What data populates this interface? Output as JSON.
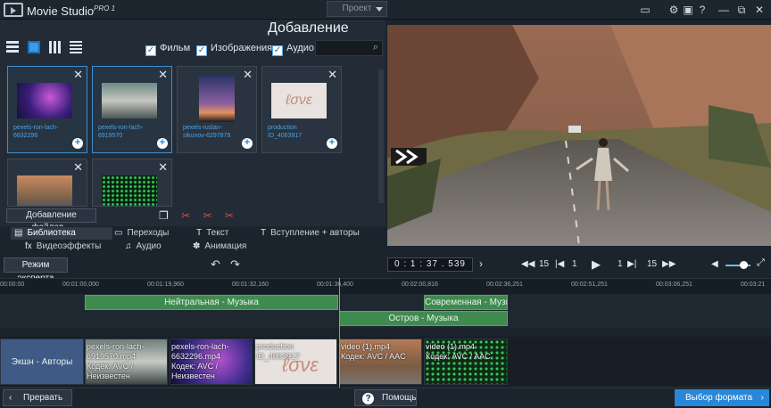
{
  "app": {
    "name": "Movie Studio",
    "edition": "PRO",
    "edition_sup": "1"
  },
  "header": {
    "project_button": "Проект"
  },
  "media": {
    "title": "Добавление",
    "filters": [
      {
        "label": "Фильм",
        "checked": true
      },
      {
        "label": "Изображения",
        "checked": true
      },
      {
        "label": "Аудио",
        "checked": true
      }
    ],
    "tiles": [
      {
        "name": "pexels-ron-lach-6632296",
        "selected": true
      },
      {
        "name": "pexels-ron-lach-6919570",
        "selected": true
      },
      {
        "name": "pexels-ruslan-sikunov-6297879",
        "selected": false
      },
      {
        "name": "production ID_4063917",
        "selected": false
      },
      {
        "name": "",
        "selected": false
      },
      {
        "name": "",
        "selected": false
      }
    ],
    "add_files_button": "Добавление файлов..."
  },
  "tabs": {
    "row1": [
      {
        "label": "Библиотека",
        "icon": "library-icon",
        "active": true
      },
      {
        "label": "Переходы",
        "icon": "transitions-icon",
        "active": false
      },
      {
        "label": "Текст",
        "icon": "text-icon",
        "active": false
      },
      {
        "label": "Вступление + авторы",
        "icon": "credits-icon",
        "active": false
      }
    ],
    "row2": [
      {
        "label": "Видеоэффекты",
        "icon": "fx-icon",
        "active": false
      },
      {
        "label": "Аудио",
        "icon": "music-note-icon",
        "active": false
      },
      {
        "label": "Анимация",
        "icon": "animation-icon",
        "active": false
      }
    ]
  },
  "controls": {
    "expert_mode": "Режим эксперта",
    "timecode": "0 : 1 : 37 . 539",
    "step_back": "15",
    "frame_back": "1",
    "frame_fwd": "1",
    "step_fwd": "15",
    "volume": 0.6
  },
  "timeline": {
    "ruler": [
      "00:00:00",
      "00:01:00,000",
      "00:01:19,960",
      "00:01:32,160",
      "00:01:36,400",
      "00:02:00,816",
      "00:02:36,251",
      "00:02:51,251",
      "00:03:06,251",
      "00:03:21"
    ],
    "audio": [
      {
        "label": "Нейтральная - Музыка",
        "track": 1
      },
      {
        "label": "Современная - Музыка",
        "track": 1
      },
      {
        "label": "Остров - Музыка",
        "track": 2
      }
    ],
    "video": [
      {
        "title": "Экшн - Авторы",
        "color": "#3f5a85"
      },
      {
        "title": "pexels-ron-lach-6919570.mp4\nКодек: AVC /\nНеизвестен",
        "color": "#6e7f7a"
      },
      {
        "title": "pexels-ron-lach-6632296.mp4\nКодек: AVC /\nНеизвестен",
        "color": "#3d2c8a"
      },
      {
        "title": "production ID_4063917",
        "color": "#e7e2de"
      },
      {
        "title": "video (1).mp4\nКодек: AVC / AAC",
        "color": "#b57b55"
      },
      {
        "title": "video (1).mp4\nКодек: AVC / AAC",
        "color": "#0e2b16"
      }
    ]
  },
  "footer": {
    "abort": "Прервать",
    "help": "Помощь",
    "format": "Выбор формата"
  }
}
